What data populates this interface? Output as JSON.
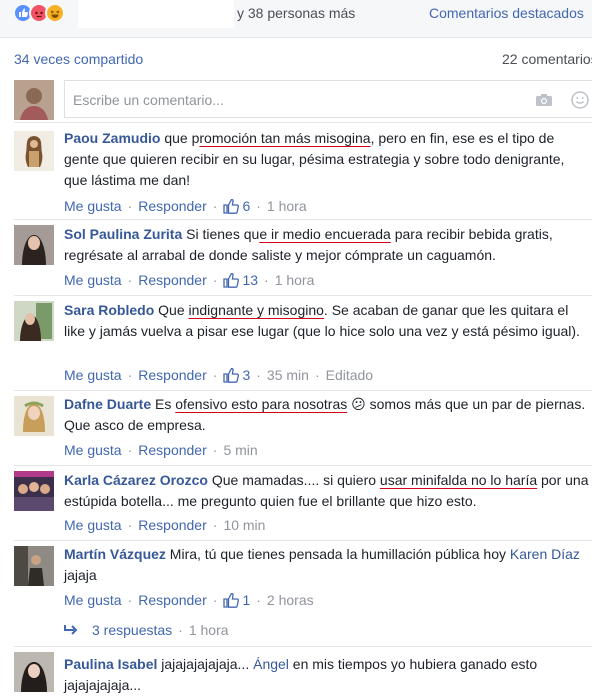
{
  "top": {
    "people_text": "y 38 personas más",
    "featured_label": "Comentarios destacados",
    "reactions": [
      "like-icon",
      "angry-icon",
      "haha-icon"
    ]
  },
  "stats": {
    "shares": "34 veces compartido",
    "comments": "22 comentarios"
  },
  "compose": {
    "placeholder": "Escribe un comentario..."
  },
  "actions": {
    "like": "Me gusta",
    "reply": "Responder"
  },
  "comments": [
    {
      "author": "Paou Zamudio",
      "t1": " que p",
      "u1": "romoción tan más misogina",
      "t2": ", pero en fin, ese es el tipo de gente que quieren recibir en su lugar, pésima estrategia y sobre todo denigrante, que lástima me dan!",
      "likes": "6",
      "time": "1 hora"
    },
    {
      "author": "Sol Paulina Zurita",
      "t1": " Si tienes qu",
      "u1": "e ir medio encuerada",
      "t2": " para recibir bebida gratis, regrésate al arrabal de donde saliste y mejor cómprate un caguamón.",
      "likes": "13",
      "time": "1 hora"
    },
    {
      "author": "Sara Robledo",
      "t1": " Que ",
      "u1": "indignante y misogino",
      "t2": ". Se acaban de ganar que les quitara el like y jamás vuelva a pisar ese lugar (que lo hice solo una vez y está pésimo igual).",
      "likes": "3",
      "time": "35 min",
      "edited": "Editado"
    },
    {
      "author": "Dafne Duarte",
      "t1": " Es ",
      "u1": "ofensivo esto para nosotras",
      "t2": " 😕 somos más que un par de piernas. Que asco de empresa.",
      "time": "5 min"
    },
    {
      "author": "Karla Cázarez Orozco",
      "t1": " Que mamadas.... si quiero ",
      "u1": "usar minifalda no lo haría",
      "t2": " por una estúpida botella... me pregunto quien fue el brillante que hizo esto.",
      "time": "10 min"
    },
    {
      "author": "Martín Vázquez",
      "t1": " Mira, tú que tienes pensada la humillación pública hoy ",
      "mention": "Karen Díaz",
      "t2": " jajaja",
      "likes": "1",
      "time": "2 horas",
      "replies": "3 respuestas",
      "replies_time": "1 hora"
    },
    {
      "author": "Paulina Isabel",
      "t1": " jajajajajajaja... ",
      "mention": "Ángel",
      "t2": " en mis tiempos yo hubiera ganado esto jajajajajaja..."
    }
  ]
}
